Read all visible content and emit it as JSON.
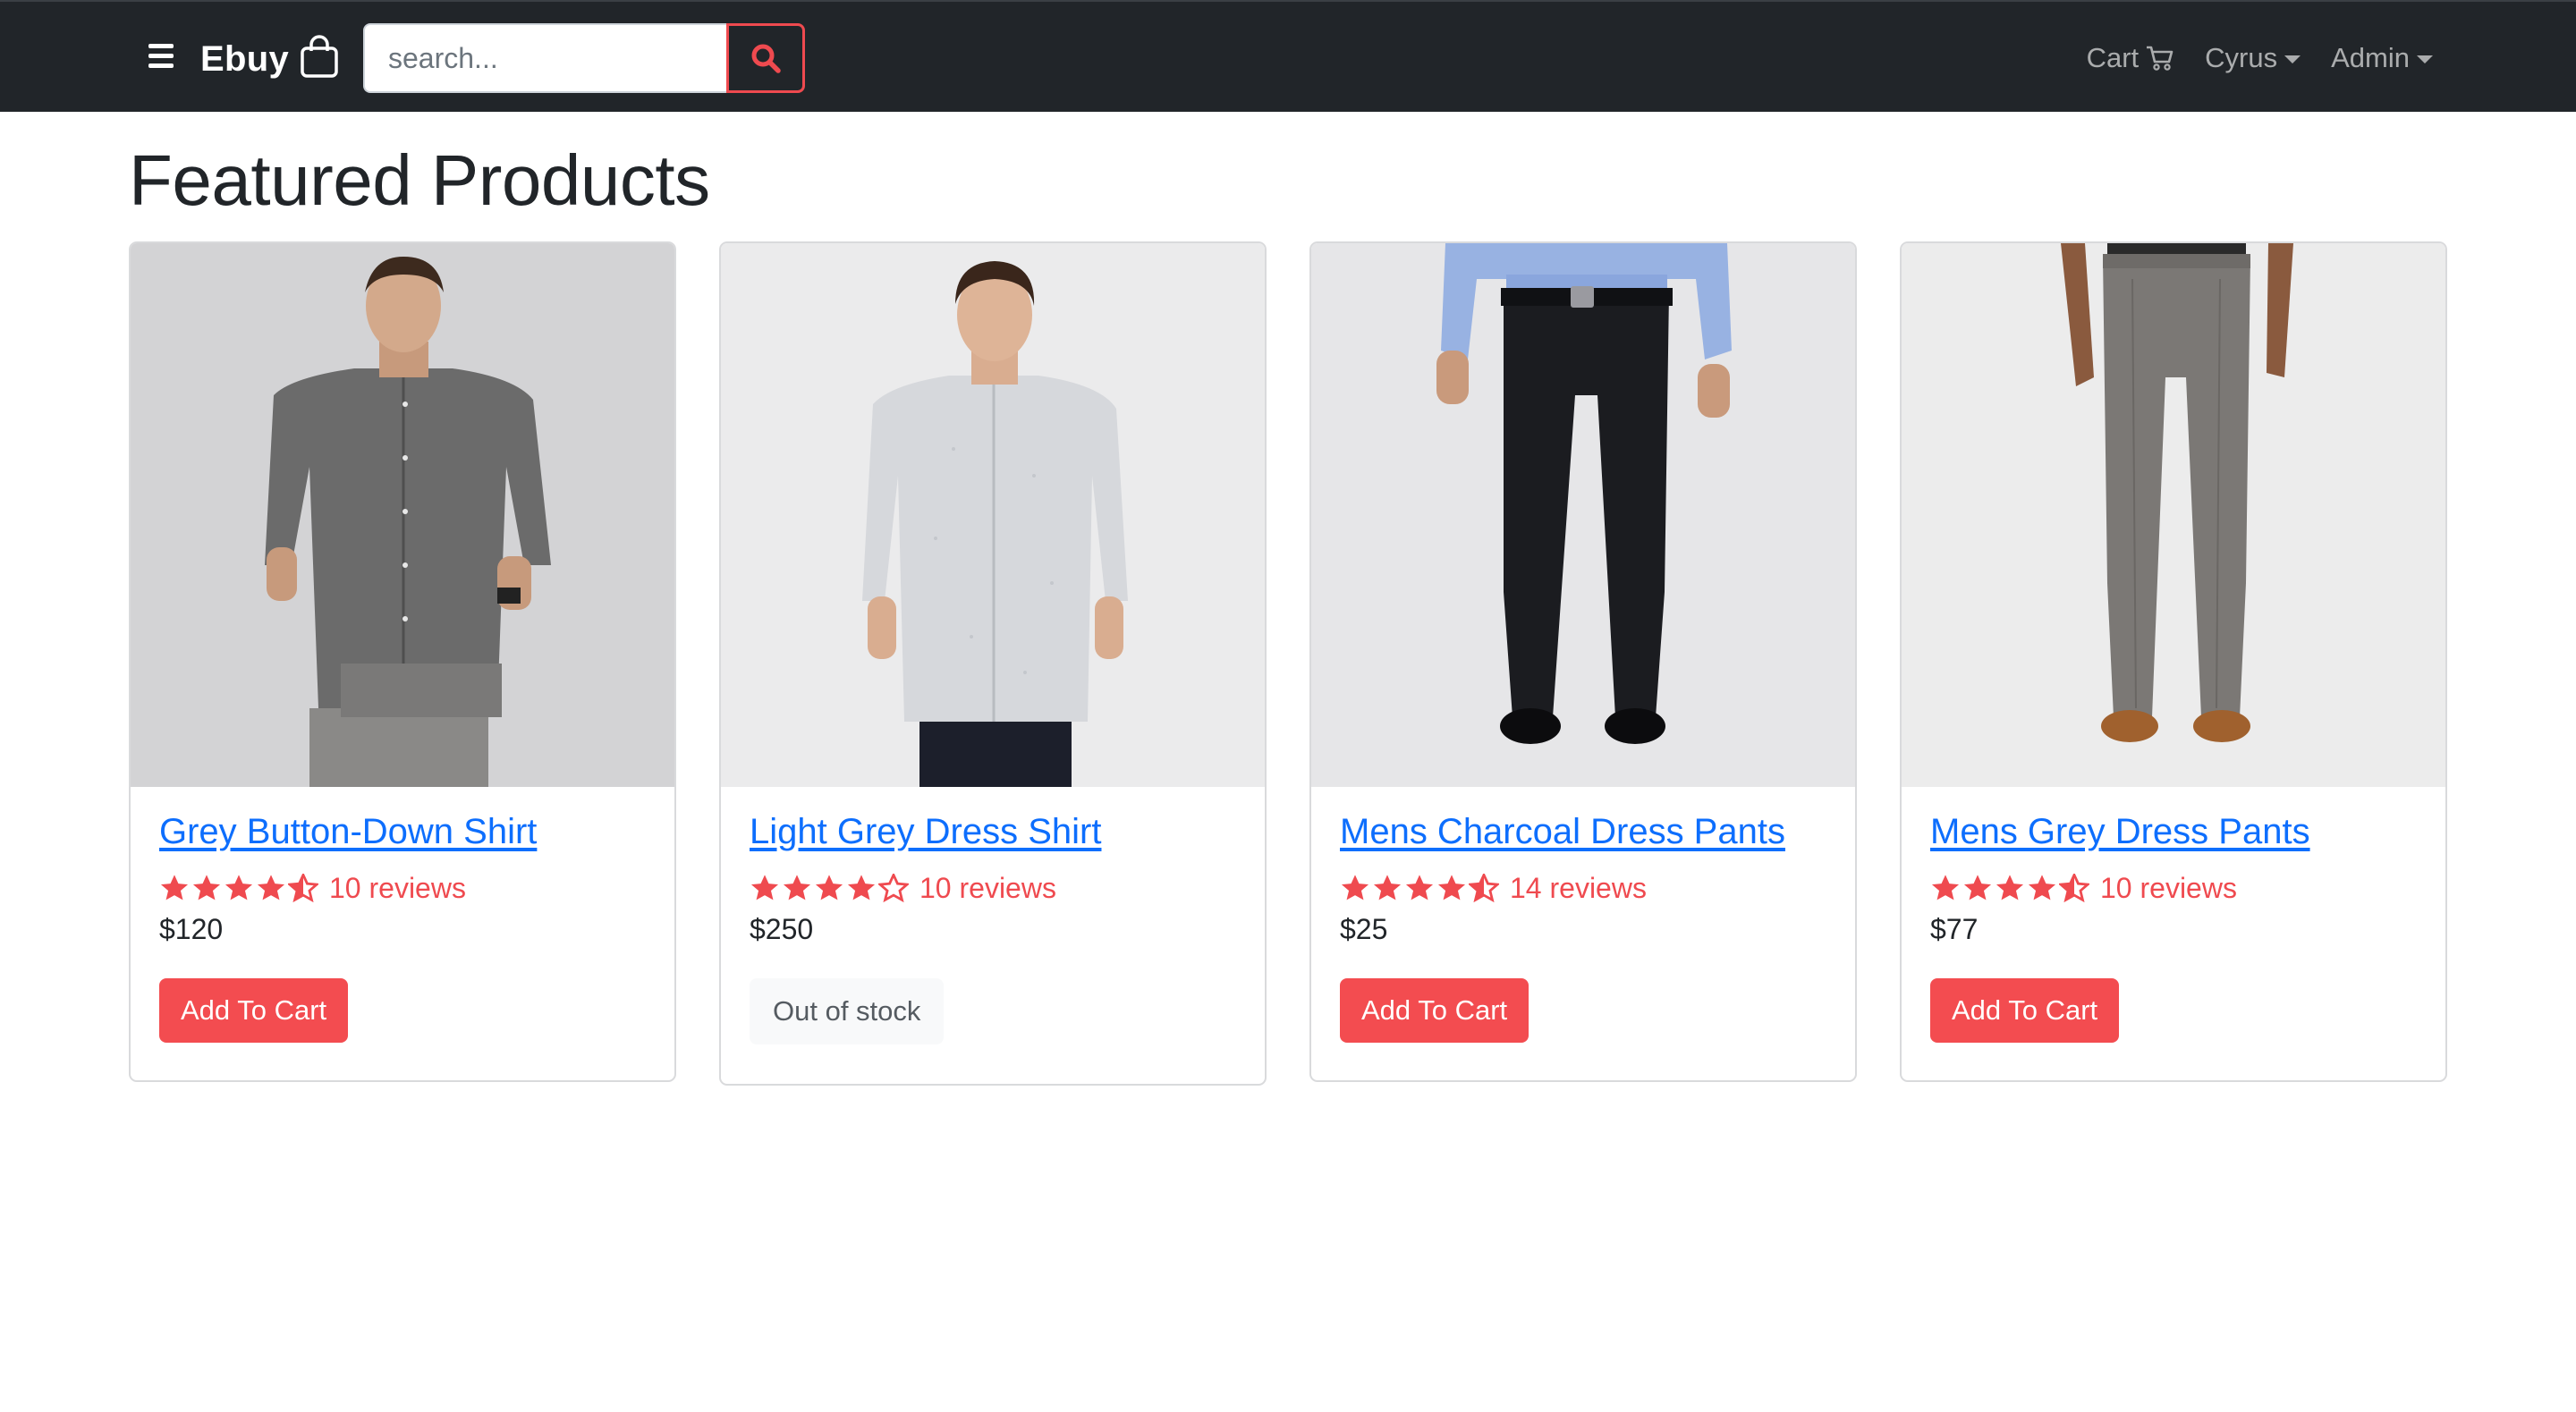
{
  "nav": {
    "brand": "Ebuy",
    "search_placeholder": "search...",
    "cart_label": "Cart",
    "user_label": "Cyrus",
    "admin_label": "Admin"
  },
  "page_title": "Featured Products",
  "products": [
    {
      "name": "Grey Button-Down Shirt",
      "rating": 4.5,
      "reviews": "10 reviews",
      "price": "$120",
      "action": "Add To Cart",
      "in_stock": true,
      "image": "man-grey-shirt"
    },
    {
      "name": "Light Grey Dress Shirt",
      "rating": 4,
      "reviews": "10 reviews",
      "price": "$250",
      "action": "Out of stock",
      "in_stock": false,
      "image": "man-light-grey-shirt"
    },
    {
      "name": "Mens Charcoal Dress Pants",
      "rating": 4.5,
      "reviews": "14 reviews",
      "price": "$25",
      "action": "Add To Cart",
      "in_stock": true,
      "image": "charcoal-pants"
    },
    {
      "name": "Mens Grey Dress Pants",
      "rating": 4.5,
      "reviews": "10 reviews",
      "price": "$77",
      "action": "Add To Cart",
      "in_stock": true,
      "image": "grey-pants"
    }
  ],
  "colors": {
    "navbar": "#212529",
    "accent": "#ef4a4f",
    "link": "#0d6efd"
  }
}
